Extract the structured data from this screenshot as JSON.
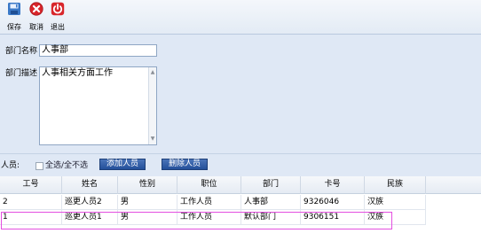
{
  "toolbar": {
    "save_label": "保存",
    "cancel_label": "取消",
    "exit_label": "退出"
  },
  "form": {
    "name_label": "部门名称",
    "name_value": "人事部",
    "desc_label": "部门描述",
    "desc_value": "人事相关方面工作"
  },
  "personnel": {
    "label": "人员:",
    "select_all_label": "全选/全不选",
    "add_button": "添加人员",
    "delete_button": "删除人员"
  },
  "grid": {
    "columns": [
      "工号",
      "姓名",
      "性别",
      "职位",
      "部门",
      "卡号",
      "民族"
    ],
    "rows": [
      [
        "2",
        "巡更人员2",
        "男",
        "工作人员",
        "人事部",
        "9326046",
        "汉族"
      ],
      [
        "1",
        "巡更人员1",
        "男",
        "工作人员",
        "默认部门",
        "9306151",
        "汉族"
      ]
    ]
  },
  "colors": {
    "save_icon": "#3a78c7",
    "cancel_icon": "#d8262b",
    "exit_icon": "#d8262b",
    "highlight": "#e44fe0",
    "button_bg": "#2d5ba6"
  }
}
